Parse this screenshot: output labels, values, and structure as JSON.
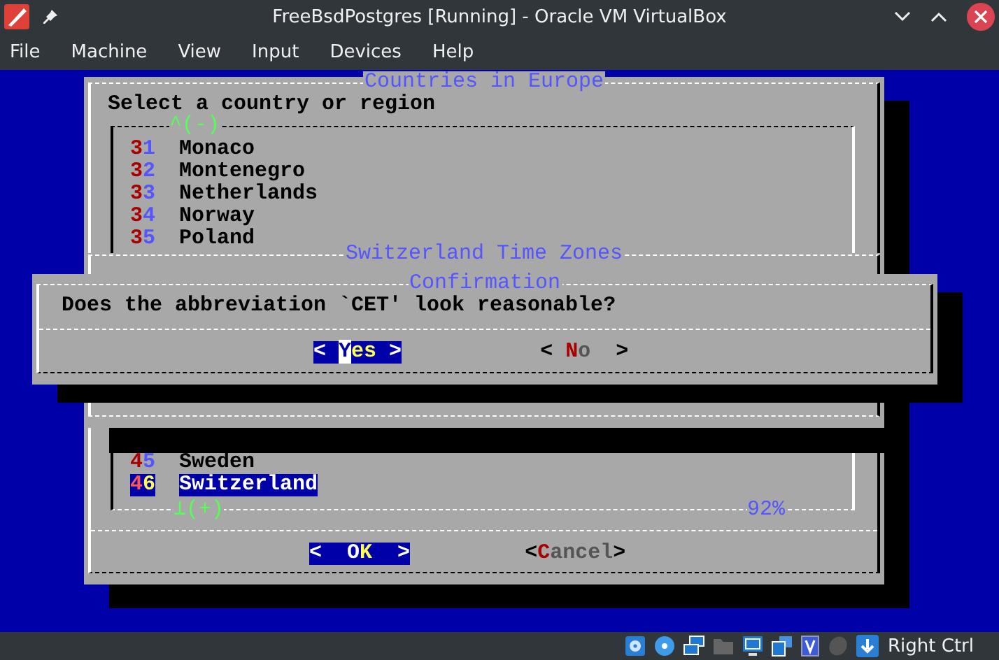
{
  "window": {
    "title": "FreeBsdPostgres [Running] - Oracle VM VirtualBox"
  },
  "menu": [
    "File",
    "Machine",
    "View",
    "Input",
    "Devices",
    "Help"
  ],
  "countries_dialog": {
    "title": "Countries in Europe",
    "prompt": "Select a country or region",
    "scroll_up": "^(-)",
    "scroll_down": "⊥(+)",
    "percent": "92%",
    "items_top": [
      {
        "number": "31",
        "name": "Monaco",
        "selected": false
      },
      {
        "number": "32",
        "name": "Montenegro",
        "selected": false
      },
      {
        "number": "33",
        "name": "Netherlands",
        "selected": false
      },
      {
        "number": "34",
        "name": "Norway",
        "selected": false
      },
      {
        "number": "35",
        "name": "Poland",
        "selected": false
      }
    ],
    "items_bottom": [
      {
        "number": "45",
        "name": "Sweden",
        "selected": false
      },
      {
        "number": "46",
        "name": "Switzerland",
        "selected": true
      }
    ],
    "buttons": [
      {
        "selected": true,
        "segments": [
          {
            "text": "<  ",
            "kind": "bracket"
          },
          {
            "text": "O",
            "kind": "hotkey"
          },
          {
            "text": "K",
            "kind": "plain"
          },
          {
            "text": "  >",
            "kind": "bracket"
          }
        ]
      },
      {
        "selected": false,
        "segments": [
          {
            "text": "<",
            "kind": "bracket"
          },
          {
            "text": "C",
            "kind": "hotkey"
          },
          {
            "text": "ancel",
            "kind": "plain"
          },
          {
            "text": ">",
            "kind": "bracket"
          }
        ]
      }
    ]
  },
  "timezones_dialog": {
    "title": "Switzerland Time Zones"
  },
  "confirmation_dialog": {
    "title": "Confirmation",
    "message": "Does the abbreviation `CET' look reasonable?",
    "buttons": [
      {
        "selected": true,
        "segments": [
          {
            "text": "< ",
            "kind": "bracket"
          },
          {
            "text": "Y",
            "kind": "cursor"
          },
          {
            "text": "es",
            "kind": "plain"
          },
          {
            "text": " >",
            "kind": "bracket"
          }
        ]
      },
      {
        "selected": false,
        "segments": [
          {
            "text": "< ",
            "kind": "bracket"
          },
          {
            "text": "N",
            "kind": "hotkey"
          },
          {
            "text": "o",
            "kind": "plain"
          },
          {
            "text": "  >",
            "kind": "bracket"
          }
        ]
      }
    ]
  },
  "status_bar": {
    "host_key": "Right Ctrl"
  }
}
